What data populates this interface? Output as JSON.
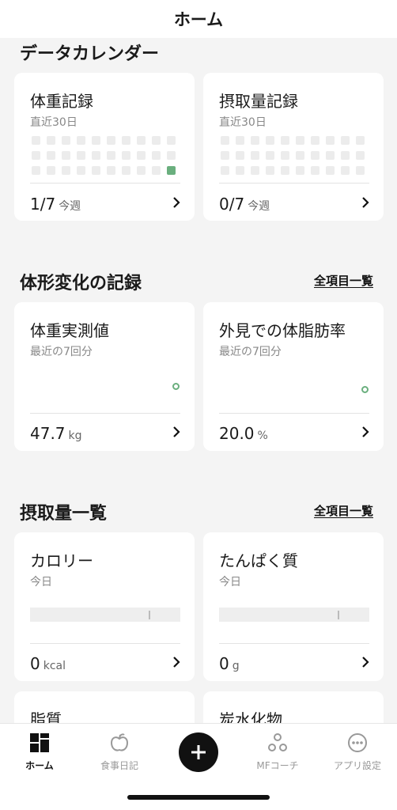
{
  "header": {
    "title": "ホーム"
  },
  "calendar": {
    "title": "データカレンダー",
    "cards": [
      {
        "title": "体重記録",
        "sub": "直近30日",
        "value": "1/7",
        "unit": "今週",
        "filled_days": [
          29
        ]
      },
      {
        "title": "摂取量記録",
        "sub": "直近30日",
        "value": "0/7",
        "unit": "今週",
        "filled_days": []
      }
    ]
  },
  "body_change": {
    "title": "体形変化の記録",
    "see_all": "全項目一覧",
    "cards": [
      {
        "title": "体重実測値",
        "sub": "最近の7回分",
        "value": "47.7",
        "unit": "kg"
      },
      {
        "title": "外見での体脂肪率",
        "sub": "最近の7回分",
        "value": "20.0",
        "unit": "%"
      }
    ]
  },
  "intake": {
    "title": "摂取量一覧",
    "see_all": "全項目一覧",
    "cards": [
      {
        "title": "カロリー",
        "sub": "今日",
        "value": "0",
        "unit": "kcal"
      },
      {
        "title": "たんぱく質",
        "sub": "今日",
        "value": "0",
        "unit": "g"
      },
      {
        "title": "脂質"
      },
      {
        "title": "炭水化物"
      }
    ]
  },
  "tabbar": {
    "items": [
      {
        "label": "ホーム",
        "icon": "home-grid-icon",
        "active": true
      },
      {
        "label": "食事日記",
        "icon": "apple-icon",
        "active": false
      },
      {
        "label": "",
        "icon": "plus-icon",
        "active": false
      },
      {
        "label": "MFコーチ",
        "icon": "coach-dots-icon",
        "active": false
      },
      {
        "label": "アプリ設定",
        "icon": "more-icon",
        "active": false
      }
    ]
  },
  "colors": {
    "accent_green": "#6aaf7e",
    "background": "#f4f4f4",
    "card": "#ffffff"
  }
}
